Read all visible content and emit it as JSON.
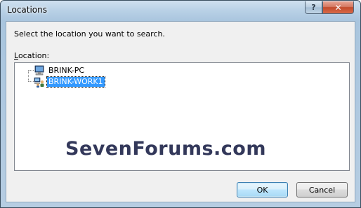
{
  "window": {
    "title": "Locations"
  },
  "titlebar": {
    "help_label": "?",
    "close_label": "✕"
  },
  "dialog": {
    "prompt": "Select the location you want to search.",
    "location_label_accel": "L",
    "location_label_rest": "ocation:"
  },
  "tree": {
    "items": [
      {
        "label": "BRINK-PC",
        "icon": "computer-icon",
        "selected": false
      },
      {
        "label": "BRINK-WORK1",
        "icon": "workgroup-icon",
        "selected": true
      }
    ]
  },
  "buttons": {
    "ok_label": "OK",
    "cancel_label": "Cancel"
  },
  "watermark": {
    "text": "SevenForums.com"
  },
  "colors": {
    "selection": "#3399ff",
    "titlebar": "#b9d1e6",
    "close": "#c24a2c"
  }
}
